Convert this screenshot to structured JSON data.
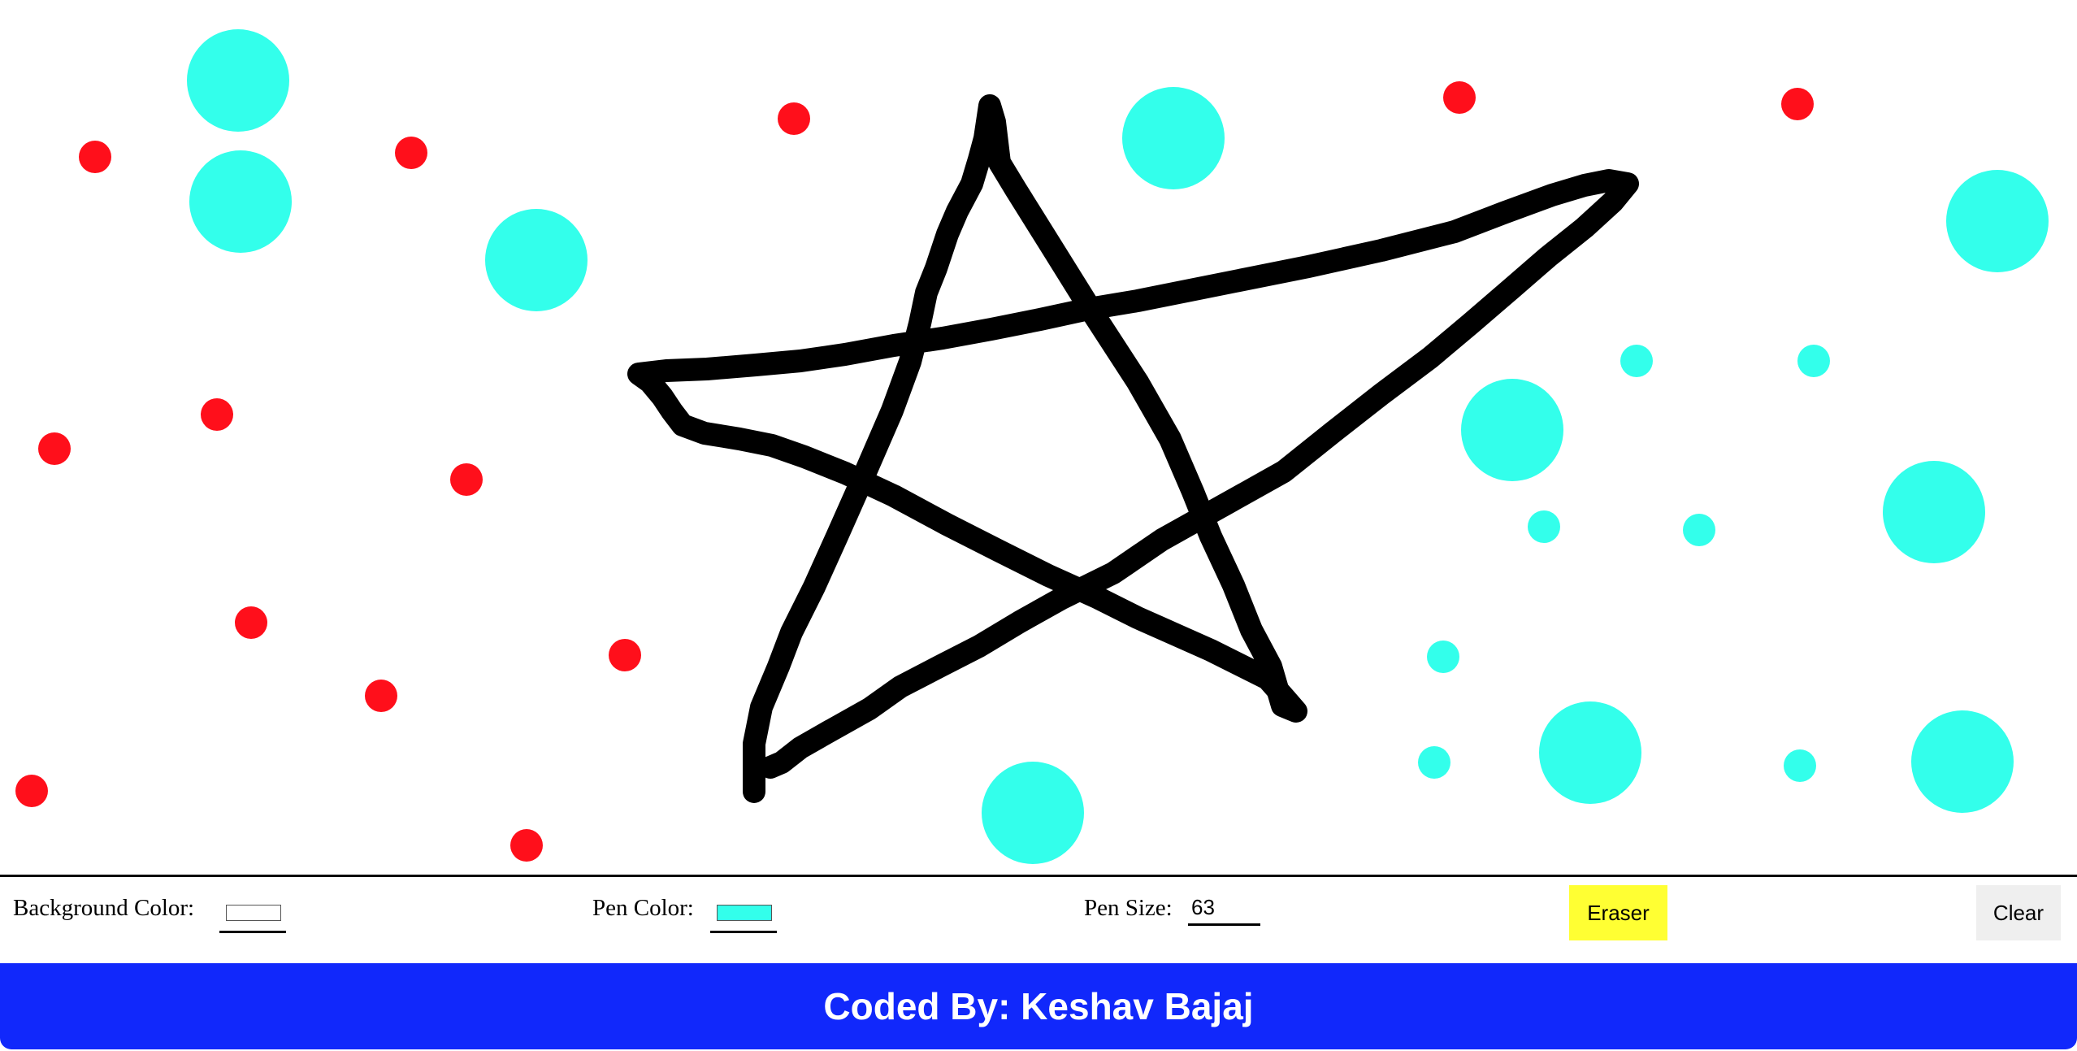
{
  "canvas": {
    "background_color": "#ffffff",
    "dot_colors": {
      "red": "#ff0f1b",
      "cyan": "#33ffeb",
      "stroke": "#000000"
    }
  },
  "toolbar": {
    "background_color_label": "Background Color:",
    "background_color_value": "#ffffff",
    "pen_color_label": "Pen Color:",
    "pen_color_value": "#33ffeb",
    "pen_size_label": "Pen Size:",
    "pen_size_value": "63",
    "eraser_label": "Eraser",
    "eraser_color": "#ffff33",
    "clear_label": "Clear",
    "clear_color": "#efefef"
  },
  "footer": {
    "text": "Coded By: Keshav Bajaj",
    "color": "#1128fb"
  }
}
